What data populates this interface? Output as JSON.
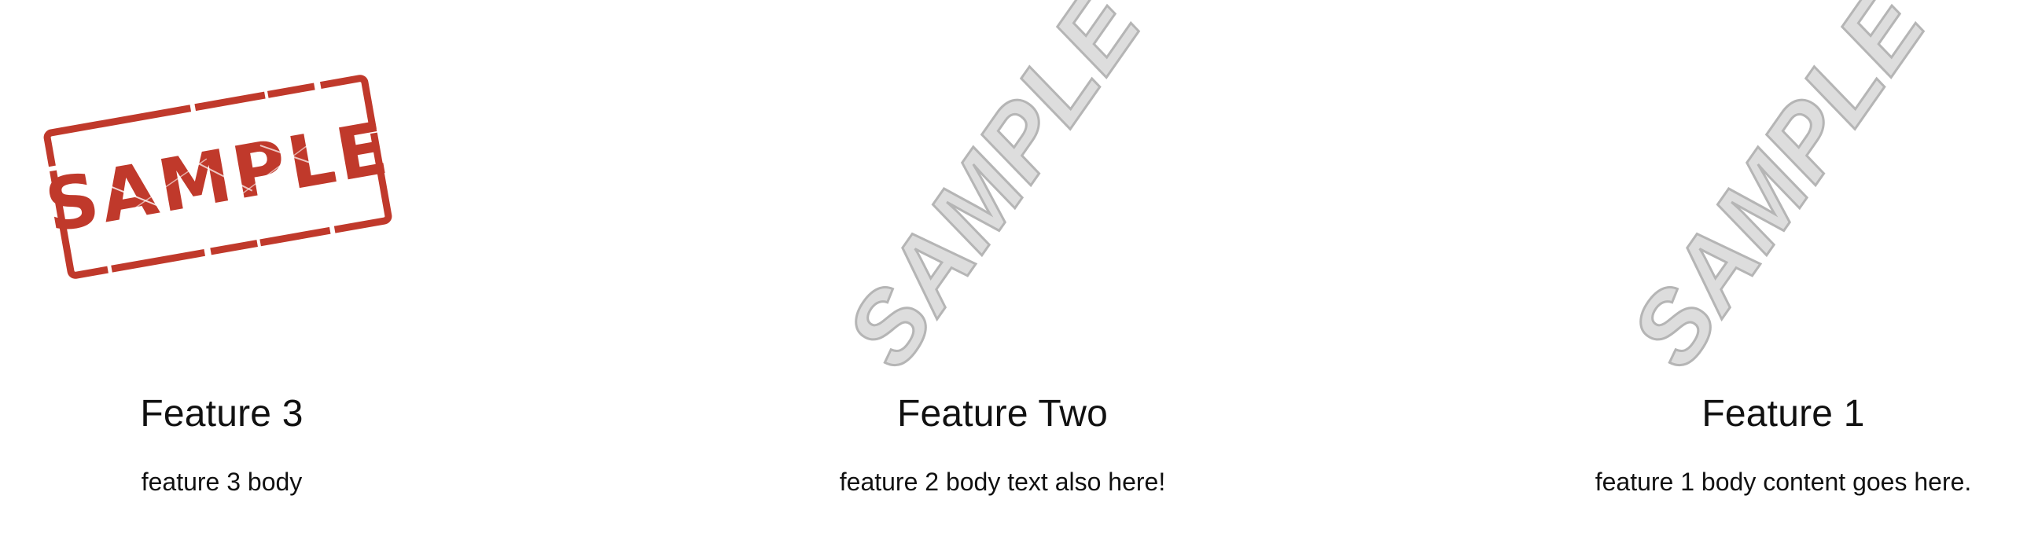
{
  "features": [
    {
      "image": {
        "kind": "stamp",
        "text": "SAMPLE",
        "color": "#c0392b"
      },
      "title": "Feature 3",
      "body": "feature 3 body"
    },
    {
      "image": {
        "kind": "watermark",
        "text": "SAMPLE",
        "color": "#c8c8c8"
      },
      "title": "Feature Two",
      "body": "feature 2 body text also here!"
    },
    {
      "image": {
        "kind": "watermark",
        "text": "SAMPLE",
        "color": "#c8c8c8"
      },
      "title": "Feature 1",
      "body": "feature 1 body content goes here."
    }
  ]
}
